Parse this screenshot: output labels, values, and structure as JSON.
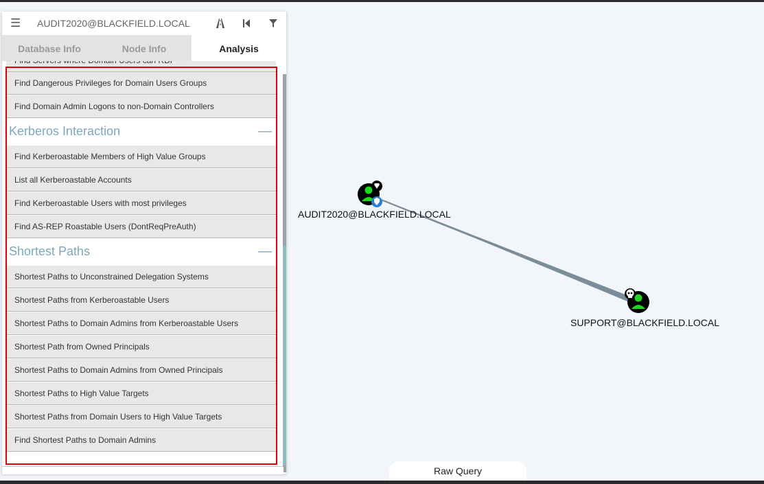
{
  "search": {
    "value": "AUDIT2020@BLACKFIELD.LOCAL"
  },
  "toolbar_icons": [
    "hamburger-icon",
    "road-path-icon",
    "back-step-icon",
    "filter-icon"
  ],
  "tabs": [
    {
      "label": "Database Info",
      "active": false
    },
    {
      "label": "Node Info",
      "active": false
    },
    {
      "label": "Analysis",
      "active": true
    }
  ],
  "analysis": {
    "partial_item": "Find Servers where Domain Users can RDP",
    "pre_items": [
      "Find Dangerous Privileges for Domain Users Groups",
      "Find Domain Admin Logons to non-Domain Controllers"
    ],
    "kerberos": {
      "title": "Kerberos Interaction",
      "toggle": "—",
      "items": [
        "Find Kerberoastable Members of High Value Groups",
        "List all Kerberoastable Accounts",
        "Find Kerberoastable Users with most privileges",
        "Find AS-REP Roastable Users (DontReqPreAuth)"
      ]
    },
    "shortest": {
      "title": "Shortest Paths",
      "toggle": "—",
      "items": [
        "Shortest Paths to Unconstrained Delegation Systems",
        "Shortest Paths from Kerberoastable Users",
        "Shortest Paths to Domain Admins from Kerberoastable Users",
        "Shortest Path from Owned Principals",
        "Shortest Paths to Domain Admins from Owned Principals",
        "Shortest Paths to High Value Targets",
        "Shortest Paths from Domain Users to High Value Targets",
        "Find Shortest Paths to Domain Admins"
      ]
    }
  },
  "graph": {
    "nodes": [
      {
        "label": "AUDIT2020@BLACKFIELD.LOCAL",
        "badges": [
          "diamond-badge-icon",
          "shield-badge-icon"
        ]
      },
      {
        "label": "SUPPORT@BLACKFIELD.LOCAL",
        "badges": [
          "skull-badge-icon"
        ]
      }
    ],
    "node_colors": {
      "fill": "#1fd71f",
      "outline": "#000000",
      "edge": "#7b8d99"
    }
  },
  "raw_query": {
    "label": "Raw Query"
  }
}
